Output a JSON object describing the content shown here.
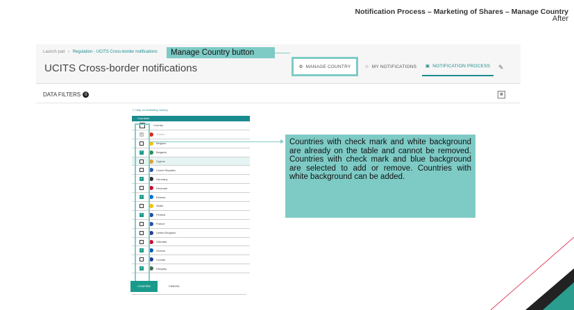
{
  "slide": {
    "title": "Notification Process – Marketing of Shares – Manage Country",
    "subtitle": "After"
  },
  "app": {
    "breadcrumb": [
      "Launch pad",
      "Regulation - UCITS Cross-border notifications"
    ],
    "page_title": "UCITS Cross-border notifications",
    "buttons": {
      "manage_country": "MANAGE COUNTRY",
      "my_notifications": "MY NOTIFICATIONS",
      "notification_process": "NOTIFICATION PROCESS"
    },
    "data_filters_label": "DATA FILTERS",
    "data_filters_count": "0",
    "help_link": "Help on marketing country",
    "countries_header": "Countries",
    "country_column": "Country",
    "countries": [
      {
        "name": "Austria",
        "state": "disabled",
        "color": "#d52b1e"
      },
      {
        "name": "Belgium",
        "state": "unchecked",
        "color": "#f2c100"
      },
      {
        "name": "Bulgaria",
        "state": "checked",
        "color": "#2e8b57"
      },
      {
        "name": "Cyprus",
        "state": "unchecked-selected",
        "color": "#e0a030"
      },
      {
        "name": "Czech Republic",
        "state": "unchecked",
        "color": "#2a5aa8"
      },
      {
        "name": "Germany",
        "state": "checked",
        "color": "#333333"
      },
      {
        "name": "Denmark",
        "state": "unchecked",
        "color": "#c8102e"
      },
      {
        "name": "Estonia",
        "state": "checked",
        "color": "#0072ce"
      },
      {
        "name": "Spain",
        "state": "unchecked",
        "color": "#f1bf00"
      },
      {
        "name": "Finland",
        "state": "checked",
        "color": "#1f4fa0"
      },
      {
        "name": "France",
        "state": "unchecked",
        "color": "#2b4fa3"
      },
      {
        "name": "United Kingdom",
        "state": "unchecked",
        "color": "#2c3e8f"
      },
      {
        "name": "Gibraltar",
        "state": "unchecked",
        "color": "#c8102e"
      },
      {
        "name": "Greece",
        "state": "checked",
        "color": "#0d5eaf"
      },
      {
        "name": "Croatia",
        "state": "unchecked",
        "color": "#1f3e8f"
      },
      {
        "name": "Hungary",
        "state": "checked",
        "color": "#477050"
      }
    ],
    "confirm": "CONFIRM",
    "cancel": "CANCEL"
  },
  "callouts": {
    "manage_button_label": "Manage Country button",
    "note": "Countries with check mark and white background are already on the table and cannot be removed. Countries with check mark and blue background are selected to add or remove. Countries with white background can be added."
  }
}
